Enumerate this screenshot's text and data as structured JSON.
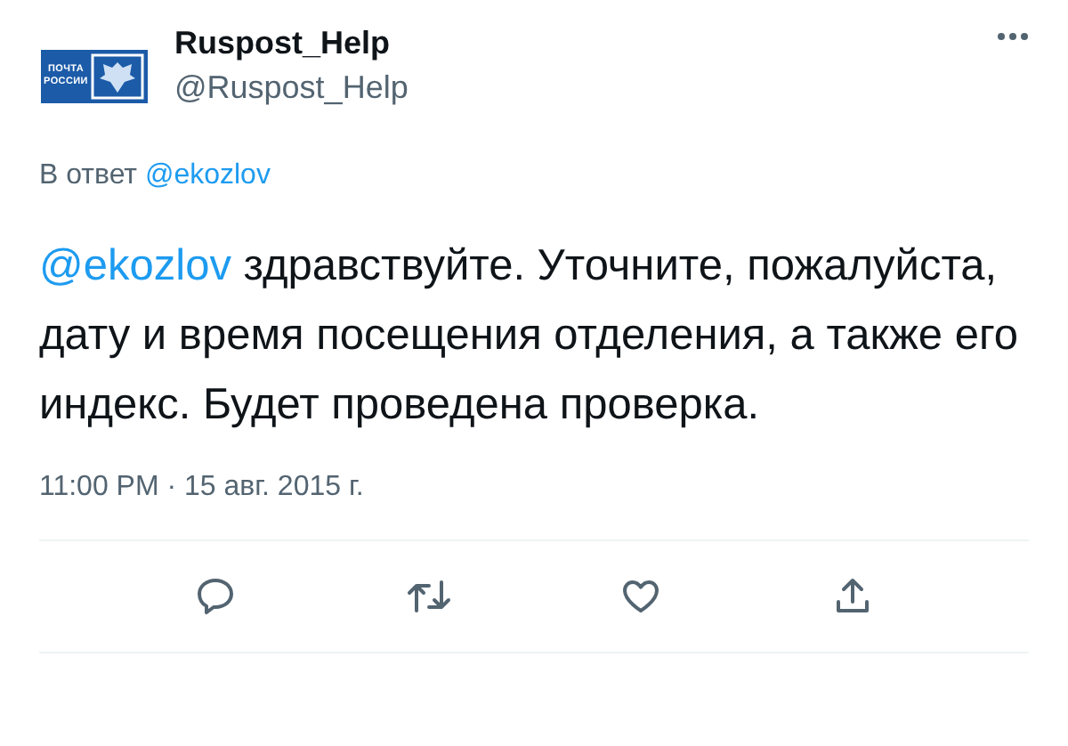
{
  "author": {
    "avatar_lines": [
      "ПОЧТА",
      "РОССИИ"
    ],
    "name": "Ruspost_Help",
    "handle": "@Ruspost_Help"
  },
  "reply_to": {
    "label": "В ответ",
    "mention": "@ekozlov"
  },
  "tweet": {
    "mention": "@ekozlov",
    "text": " здравствуйте. Уточните, пожалуйста, дату и время посещения отделения, а также его индекс. Будет проведена проверка."
  },
  "timestamp": "11:00 PM · 15 авг. 2015 г.",
  "actions": [
    {
      "kind": "reply"
    },
    {
      "kind": "retweet"
    },
    {
      "kind": "like"
    },
    {
      "kind": "share"
    }
  ]
}
